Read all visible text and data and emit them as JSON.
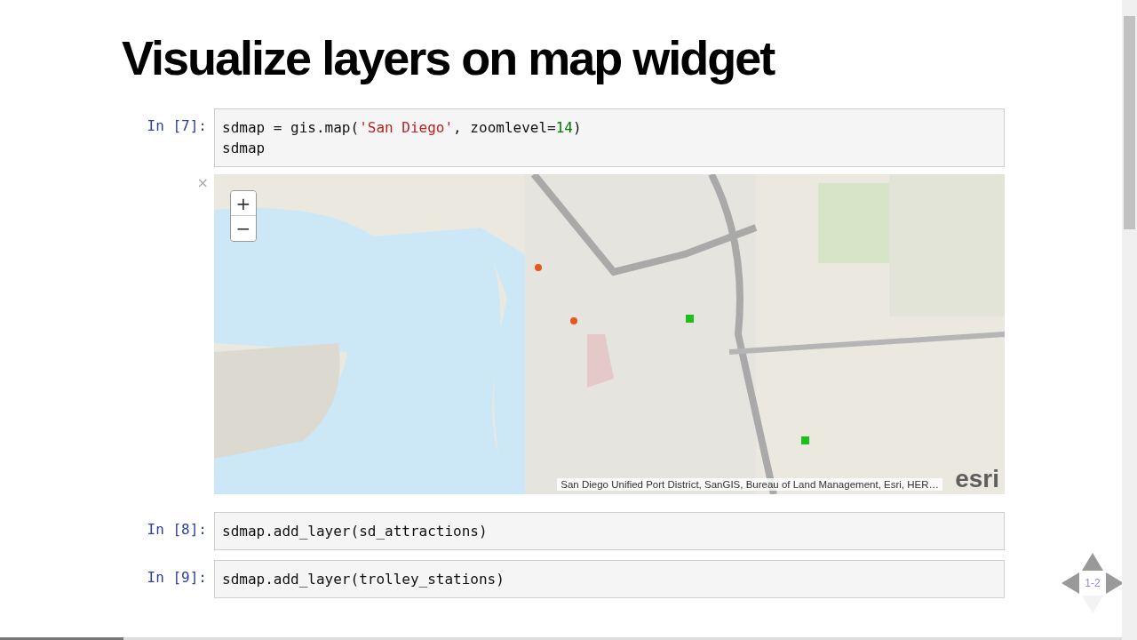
{
  "title": "Visualize layers on map widget",
  "cells": [
    {
      "prompt": "In [7]:",
      "lines": [
        [
          {
            "kind": "plain",
            "text": "sdmap = gis.map("
          },
          {
            "kind": "string",
            "text": "'San Diego'"
          },
          {
            "kind": "plain",
            "text": ", zoomlevel="
          },
          {
            "kind": "number",
            "text": "14"
          },
          {
            "kind": "plain",
            "text": ")"
          }
        ],
        [
          {
            "kind": "plain",
            "text": "sdmap"
          }
        ]
      ],
      "output": {
        "kind": "map",
        "close": "×",
        "zoom_in": "+",
        "zoom_out": "−",
        "attribution": "San Diego Unified Port District, SanGIS, Bureau of Land Management, Esri, HER…",
        "logo": "esri"
      }
    },
    {
      "prompt": "In [8]:",
      "lines": [
        [
          {
            "kind": "plain",
            "text": "sdmap.add_layer(sd_attractions)"
          }
        ]
      ]
    },
    {
      "prompt": "In [9]:",
      "lines": [
        [
          {
            "kind": "plain",
            "text": "sdmap.add_layer(trolley_stations)"
          }
        ]
      ]
    }
  ],
  "slide_nav": {
    "label": "1-2",
    "up": {
      "enabled": true
    },
    "left": {
      "enabled": true
    },
    "right": {
      "enabled": true
    },
    "down": {
      "enabled": false
    }
  },
  "progress": {
    "level": 0.11
  }
}
